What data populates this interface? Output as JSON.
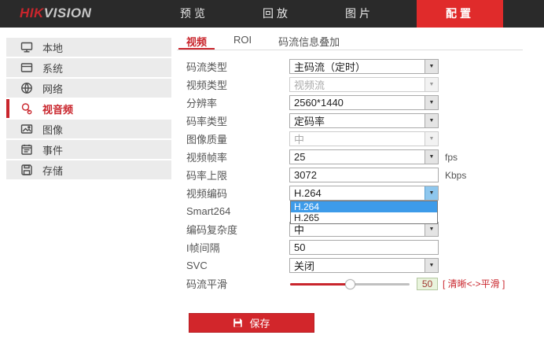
{
  "topbar": {
    "logo": {
      "hik": "HIK",
      "vision": "VISION"
    },
    "nav": [
      {
        "label": "预览",
        "active": false
      },
      {
        "label": "回放",
        "active": false
      },
      {
        "label": "图片",
        "active": false
      },
      {
        "label": "配置",
        "active": true
      }
    ]
  },
  "sidebar": {
    "items": [
      {
        "label": "本地",
        "icon": "monitor-icon",
        "active": false
      },
      {
        "label": "系统",
        "icon": "system-window-icon",
        "active": false
      },
      {
        "label": "网络",
        "icon": "network-globe-icon",
        "active": false
      },
      {
        "label": "视音频",
        "icon": "video-audio-icon",
        "active": true
      },
      {
        "label": "图像",
        "icon": "image-icon",
        "active": false
      },
      {
        "label": "事件",
        "icon": "event-calendar-icon",
        "active": false
      },
      {
        "label": "存储",
        "icon": "storage-disk-icon",
        "active": false
      }
    ]
  },
  "tabs": [
    {
      "label": "视频",
      "active": true
    },
    {
      "label": "ROI",
      "active": false
    },
    {
      "label": "码流信息叠加",
      "active": false
    }
  ],
  "form": {
    "fields": [
      {
        "label": "码流类型",
        "type": "select",
        "value": "主码流（定时）",
        "disabled": false
      },
      {
        "label": "视频类型",
        "type": "select",
        "value": "视频流",
        "disabled": true
      },
      {
        "label": "分辨率",
        "type": "select",
        "value": "2560*1440",
        "disabled": false
      },
      {
        "label": "码率类型",
        "type": "select",
        "value": "定码率",
        "disabled": false
      },
      {
        "label": "图像质量",
        "type": "select",
        "value": "中",
        "disabled": true
      },
      {
        "label": "视频帧率",
        "type": "select",
        "value": "25",
        "suffix": "fps",
        "disabled": false
      },
      {
        "label": "码率上限",
        "type": "input",
        "value": "3072",
        "suffix": "Kbps"
      },
      {
        "label": "视频编码",
        "type": "select-open",
        "value": "H.264",
        "options": [
          "H.264",
          "H.265"
        ],
        "highlighted_option": "H.264"
      },
      {
        "label": "Smart264",
        "type": "select-hidden-behind-dropdown",
        "value": ""
      },
      {
        "label": "编码复杂度",
        "type": "select",
        "value": "中",
        "disabled": false
      },
      {
        "label": "I帧间隔",
        "type": "input",
        "value": "50"
      },
      {
        "label": "SVC",
        "type": "select",
        "value": "关闭",
        "disabled": false
      },
      {
        "label": "码流平滑",
        "type": "slider",
        "value": "50",
        "percent": 50,
        "hint": "[ 清晰<->平滑 ]"
      }
    ],
    "save_label": "保存"
  },
  "colors": {
    "accent_red": "#c9252c",
    "nav_active_bg": "#e02b2b",
    "save_button_bg": "#d2262b",
    "topbar_bg": "#2a2a2a",
    "dropdown_highlight": "#3d9be9",
    "sidebar_item_bg": "#ebebeb",
    "slider_value_bg": "#e9f4dd"
  }
}
